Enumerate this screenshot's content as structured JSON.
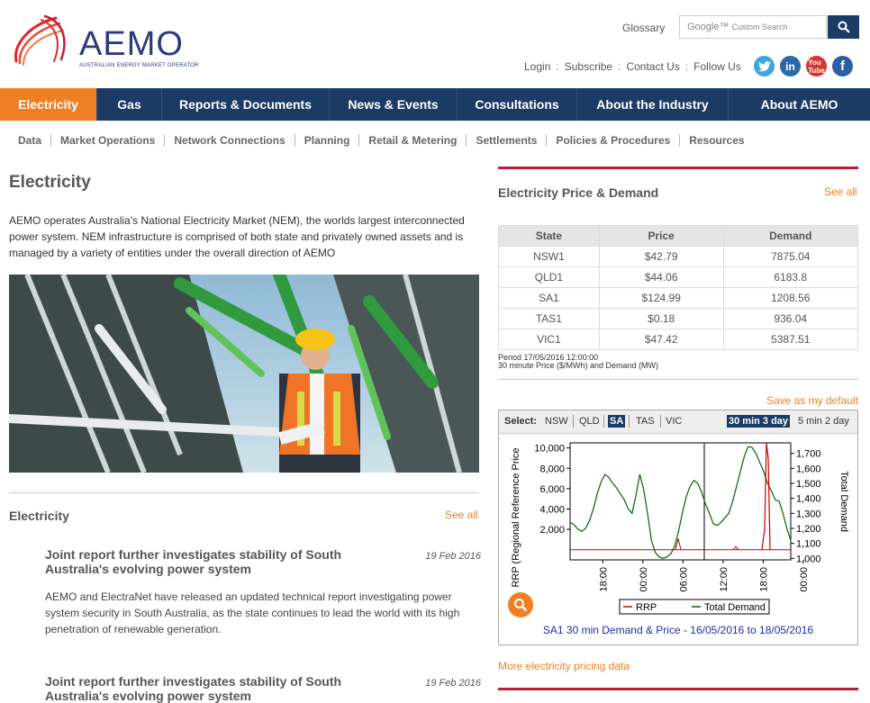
{
  "header": {
    "logo_text": "AEMO",
    "logo_sub": "AUSTRALIAN ENERGY MARKET OPERATOR",
    "glossary": "Glossary",
    "search_placeholder": "Custom Search",
    "search_brand": "Google™",
    "links": [
      "Login",
      "Subscribe",
      "Contact Us"
    ],
    "follow_us": "Follow Us",
    "social": [
      {
        "name": "twitter",
        "color": "#3aa7e0",
        "glyph": "t"
      },
      {
        "name": "linkedin",
        "color": "#2b6aa8",
        "glyph": "in"
      },
      {
        "name": "youtube",
        "color": "#d6352b",
        "glyph": "▶"
      },
      {
        "name": "facebook",
        "color": "#2d5ea4",
        "glyph": "f"
      }
    ]
  },
  "nav": {
    "items": [
      "Electricity",
      "Gas",
      "Reports & Documents",
      "News & Events",
      "Consultations",
      "About the Industry",
      "About AEMO"
    ],
    "active": "Electricity"
  },
  "subnav": [
    "Data",
    "Market Operations",
    "Network Connections",
    "Planning",
    "Retail & Metering",
    "Settlements",
    "Policies & Procedures",
    "Resources"
  ],
  "main": {
    "title": "Electricity",
    "intro": "AEMO operates Australia's National Electricity Market (NEM), the worlds largest interconnected power system. NEM infrastructure is comprised of both state and privately owned assets and is managed by a variety of entities under the overall direction of AEMO",
    "section_title": "Electricity",
    "see_all": "See all",
    "news": [
      {
        "title": "Joint report further investigates stability of South Australia's evolving power system",
        "date": "19 Feb 2016",
        "body": "AEMO and ElectraNet have released an updated technical report investigating power system security in South Australia, as the state continues to lead the world with its high penetration of renewable generation."
      },
      {
        "title": "Joint report further investigates stability of South Australia's evolving power system",
        "date": "19 Feb 2016",
        "body": ""
      }
    ]
  },
  "price_demand": {
    "title": "Electricity Price & Demand",
    "see_all": "See all",
    "columns": [
      "State",
      "Price",
      "Demand"
    ],
    "rows": [
      [
        "NSW1",
        "$42.79",
        "7875.04"
      ],
      [
        "QLD1",
        "$44.06",
        "6183.8"
      ],
      [
        "SA1",
        "$124.99",
        "1208.56"
      ],
      [
        "TAS1",
        "$0.18",
        "936.04"
      ],
      [
        "VIC1",
        "$47.42",
        "5387.51"
      ]
    ],
    "period": "Period 17/05/2016 12:00:00",
    "period_note": "30 minute Price ($/MWh) and Demand (MW)",
    "save_default": "Save as my default",
    "more_link": "More electricity pricing data"
  },
  "chart": {
    "select_label": "Select:",
    "regions": [
      "NSW",
      "QLD",
      "SA",
      "TAS",
      "VIC"
    ],
    "region_selected": "SA",
    "ranges": [
      "30 min 3 day",
      "5 min 2 day"
    ],
    "range_selected": "30 min 3 day",
    "caption": "SA1 30 min Demand & Price - 16/05/2016 to 18/05/2016",
    "colors": {
      "rrp": "#cc0000",
      "demand": "#006600",
      "accent": "#f07f24"
    }
  },
  "chart_data": {
    "type": "line",
    "ylabel_left": "RRP (Regional Reference Price",
    "ylabel_right": "Total Demand",
    "y_left_ticks": [
      "10,000",
      "8,000",
      "6,000",
      "4,000",
      "2,000"
    ],
    "y_left_range": [
      -1000,
      10500
    ],
    "y_right_ticks": [
      "1,700",
      "1,600",
      "1,500",
      "1,400",
      "1,300",
      "1,200",
      "1,100",
      "1,000"
    ],
    "y_right_range": [
      990,
      1770
    ],
    "x_ticks": [
      "18:00",
      "00:00",
      "06:00",
      "12:00",
      "18:00",
      "00:00"
    ],
    "legend": [
      "RRP",
      "Total Demand"
    ],
    "series": [
      {
        "name": "Total Demand",
        "axis": "right",
        "values": [
          1240,
          1225,
          1195,
          1180,
          1200,
          1250,
          1330,
          1430,
          1510,
          1560,
          1540,
          1500,
          1470,
          1430,
          1390,
          1330,
          1300,
          1420,
          1560,
          1460,
          1300,
          1120,
          1040,
          1010,
          1000,
          1010,
          1030,
          1080,
          1180,
          1300,
          1410,
          1480,
          1520,
          1500,
          1440,
          1360,
          1300,
          1230,
          1220,
          1240,
          1270,
          1300,
          1380,
          1480,
          1580,
          1680,
          1745,
          1740,
          1700,
          1640,
          1580,
          1500,
          1450,
          1390,
          1380,
          1300,
          1200,
          1120
        ]
      },
      {
        "name": "RRP",
        "axis": "left",
        "values": [
          0,
          0,
          0,
          0,
          0,
          0,
          0,
          0,
          0,
          0,
          0,
          0,
          0,
          0,
          0,
          0,
          0,
          0,
          0,
          0,
          0,
          0,
          0,
          0,
          0,
          0,
          0,
          0,
          0,
          0,
          0,
          0,
          0,
          0,
          0,
          0,
          0,
          0,
          0,
          0,
          0,
          0,
          0,
          0,
          0,
          0,
          0,
          0,
          0,
          0,
          0,
          0,
          0,
          0,
          0,
          0,
          0,
          0
        ]
      }
    ]
  }
}
